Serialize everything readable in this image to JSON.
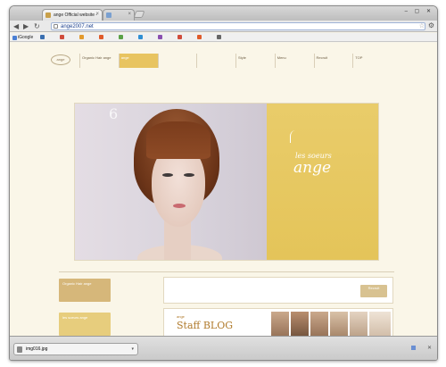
{
  "browser": {
    "tabs": [
      {
        "label": "ange Official website -",
        "active": true
      },
      {
        "label": "",
        "active": false
      }
    ],
    "url": "ange2007.net",
    "bookmarks": [
      "iGoogle",
      "",
      "",
      "",
      "",
      "",
      "",
      "",
      "",
      "",
      ""
    ],
    "other_bookmarks": "",
    "window_controls": "– ▢ ✕"
  },
  "page": {
    "top_tagline": "",
    "logo": "ange",
    "nav": [
      {
        "big": "",
        "label": "Organic Hair ange",
        "sub": ""
      },
      {
        "big": "",
        "label": "ange",
        "sub": "",
        "active": true
      },
      {
        "big": "",
        "label": "",
        "sub": ""
      },
      {
        "big": "",
        "label": "",
        "sub": ""
      },
      {
        "big": "",
        "label": "Style",
        "sub": ""
      },
      {
        "big": "",
        "label": "Menu",
        "sub": ""
      },
      {
        "big": "",
        "label": "Recruit",
        "sub": ""
      },
      {
        "big": "",
        "label": "TOP",
        "sub": ""
      }
    ],
    "subtitle": "",
    "hero": {
      "photo_number": "6",
      "panel_small": "",
      "panel_brand_1": "les soeurs",
      "panel_brand_2": "ange",
      "panel_tagline": ""
    },
    "welcome": "",
    "sidebar": {
      "heading": "",
      "card1_text": "Organic Hair ange",
      "card1_caption": "",
      "card2_text": "les soeurs ange",
      "card2_caption": "",
      "heading2": ""
    },
    "content": {
      "recruit_text": "",
      "recruit_button": "Recruit",
      "recruit_caption": "",
      "blog_small": "ange",
      "blog_title": "Staff BLOG",
      "blog_sub": "",
      "blog_caption": ""
    }
  },
  "downloads": {
    "file": "img016.jpg",
    "show_all": "",
    "close": "✕"
  }
}
